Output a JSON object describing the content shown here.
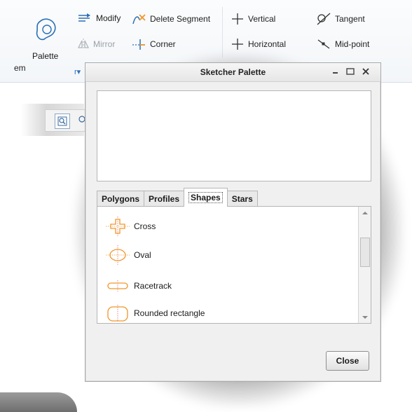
{
  "ribbon": {
    "palette_label": "Palette",
    "truncated_left_label": "em",
    "modify": "Modify",
    "delete_segment": "Delete Segment",
    "vertical": "Vertical",
    "tangent": "Tangent",
    "mirror": "Mirror",
    "corner": "Corner",
    "horizontal": "Horizontal",
    "mid_point": "Mid-point"
  },
  "dialog": {
    "title": "Sketcher Palette",
    "tabs": [
      {
        "label": "Polygons",
        "active": false
      },
      {
        "label": "Profiles",
        "active": false
      },
      {
        "label": "Shapes",
        "active": true
      },
      {
        "label": "Stars",
        "active": false
      }
    ],
    "shapes": [
      {
        "label": "Cross",
        "icon": "cross-shape-icon"
      },
      {
        "label": "Oval",
        "icon": "oval-shape-icon"
      },
      {
        "label": "Racetrack",
        "icon": "racetrack-shape-icon"
      },
      {
        "label": "Rounded rectangle",
        "icon": "rounded-rectangle-shape-icon"
      }
    ],
    "close_label": "Close"
  },
  "colors": {
    "accent_orange": "#f0962a",
    "icon_blue": "#2a6fb5",
    "ribbon_bg": "#f7f9fb",
    "dialog_bg": "#f0f0f0"
  }
}
